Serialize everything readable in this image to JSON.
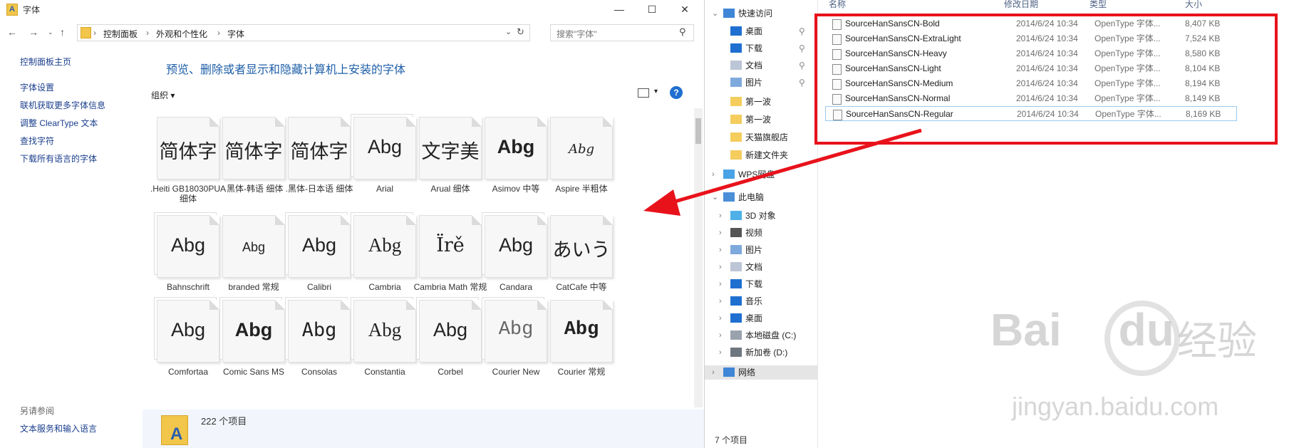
{
  "left_window": {
    "title": "字体",
    "controls": {
      "minimize": "—",
      "maximize": "☐",
      "close": "✕"
    },
    "breadcrumb": [
      "控制面板",
      "外观和个性化",
      "字体"
    ],
    "search_placeholder": "搜索\"字体\"",
    "nav": {
      "home": "控制面板主页",
      "links": [
        "字体设置",
        "联机获取更多字体信息",
        "调整 ClearType 文本",
        "查找字符",
        "下载所有语言的字体"
      ],
      "see_also_heading": "另请参阅",
      "see_also_links": [
        "文本服务和输入语言"
      ]
    },
    "heading": "预览、删除或者显示和隐藏计算机上安装的字体",
    "toolbar": {
      "organize_label": "组织 ▾",
      "help": "?"
    },
    "fonts": [
      {
        "sample": "简体字",
        "name": ".Heiti GB18030PUA 细体",
        "stack": false
      },
      {
        "sample": "简体字",
        "name": ".黑体-韩语 细体",
        "stack": false
      },
      {
        "sample": "简体字",
        "name": ".黑体-日本语 细体",
        "stack": false
      },
      {
        "sample": "Abg",
        "name": "Arial",
        "stack": true
      },
      {
        "sample": "文字美",
        "name": "Arual 细体",
        "stack": false
      },
      {
        "sample": "Abg",
        "name": "Asimov 中等",
        "stack": false
      },
      {
        "sample": "Abg",
        "name": "Aspire 半粗体",
        "stack": false
      },
      {
        "sample": "Abg",
        "name": "Bahnschrift",
        "stack": true
      },
      {
        "sample": "Abg",
        "name": "branded 常规",
        "stack": false
      },
      {
        "sample": "Abg",
        "name": "Calibri",
        "stack": true
      },
      {
        "sample": "Abg",
        "name": "Cambria",
        "stack": true
      },
      {
        "sample": "Ïrě",
        "name": "Cambria Math 常规",
        "stack": false
      },
      {
        "sample": "Abg",
        "name": "Candara",
        "stack": true
      },
      {
        "sample": "あいう",
        "name": "CatCafe 中等",
        "stack": false
      },
      {
        "sample": "Abg",
        "name": "Comfortaa",
        "stack": true
      },
      {
        "sample": "Abg",
        "name": "Comic Sans MS",
        "stack": true
      },
      {
        "sample": "Abg",
        "name": "Consolas",
        "stack": true
      },
      {
        "sample": "Abg",
        "name": "Constantia",
        "stack": true
      },
      {
        "sample": "Abg",
        "name": "Corbel",
        "stack": true
      },
      {
        "sample": "Abg",
        "name": "Courier New",
        "stack": true
      },
      {
        "sample": "Abg",
        "name": "Courier 常规",
        "stack": false
      }
    ],
    "status": "222 个项目"
  },
  "right_window": {
    "tree": {
      "quick_access": "快速访问",
      "pinned": [
        "桌面",
        "下载",
        "文档",
        "图片"
      ],
      "recent": [
        "第一波",
        "第一波",
        "天猫旗舰店",
        "新建文件夹"
      ],
      "wps": "WPS网盘",
      "this_pc": "此电脑",
      "pc_items": [
        "3D 对象",
        "视频",
        "图片",
        "文档",
        "下载",
        "音乐",
        "桌面",
        "本地磁盘 (C:)",
        "新加卷 (D:)"
      ],
      "network": "网络"
    },
    "columns": {
      "name": "名称",
      "date": "修改日期",
      "type": "类型",
      "size": "大小"
    },
    "files": [
      {
        "name": "SourceHanSansCN-Bold",
        "date": "2014/6/24 10:34",
        "type": "OpenType 字体...",
        "size": "8,407 KB"
      },
      {
        "name": "SourceHanSansCN-ExtraLight",
        "date": "2014/6/24 10:34",
        "type": "OpenType 字体...",
        "size": "7,524 KB"
      },
      {
        "name": "SourceHanSansCN-Heavy",
        "date": "2014/6/24 10:34",
        "type": "OpenType 字体...",
        "size": "8,580 KB"
      },
      {
        "name": "SourceHanSansCN-Light",
        "date": "2014/6/24 10:34",
        "type": "OpenType 字体...",
        "size": "8,104 KB"
      },
      {
        "name": "SourceHanSansCN-Medium",
        "date": "2014/6/24 10:34",
        "type": "OpenType 字体...",
        "size": "8,194 KB"
      },
      {
        "name": "SourceHanSansCN-Normal",
        "date": "2014/6/24 10:34",
        "type": "OpenType 字体...",
        "size": "8,149 KB"
      },
      {
        "name": "SourceHanSansCN-Regular",
        "date": "2014/6/24 10:34",
        "type": "OpenType 字体...",
        "size": "8,169 KB"
      }
    ],
    "status": "7 个项目"
  },
  "watermark": {
    "brand": "Bai",
    "brand2": "du",
    "cn": "经验",
    "url": "jingyan.baidu.com"
  },
  "colors": {
    "accent": "#1f5fa8",
    "highlight_box": "#e8121b",
    "arrow": "#e8121b",
    "status_bg": "#f2f6fc"
  }
}
